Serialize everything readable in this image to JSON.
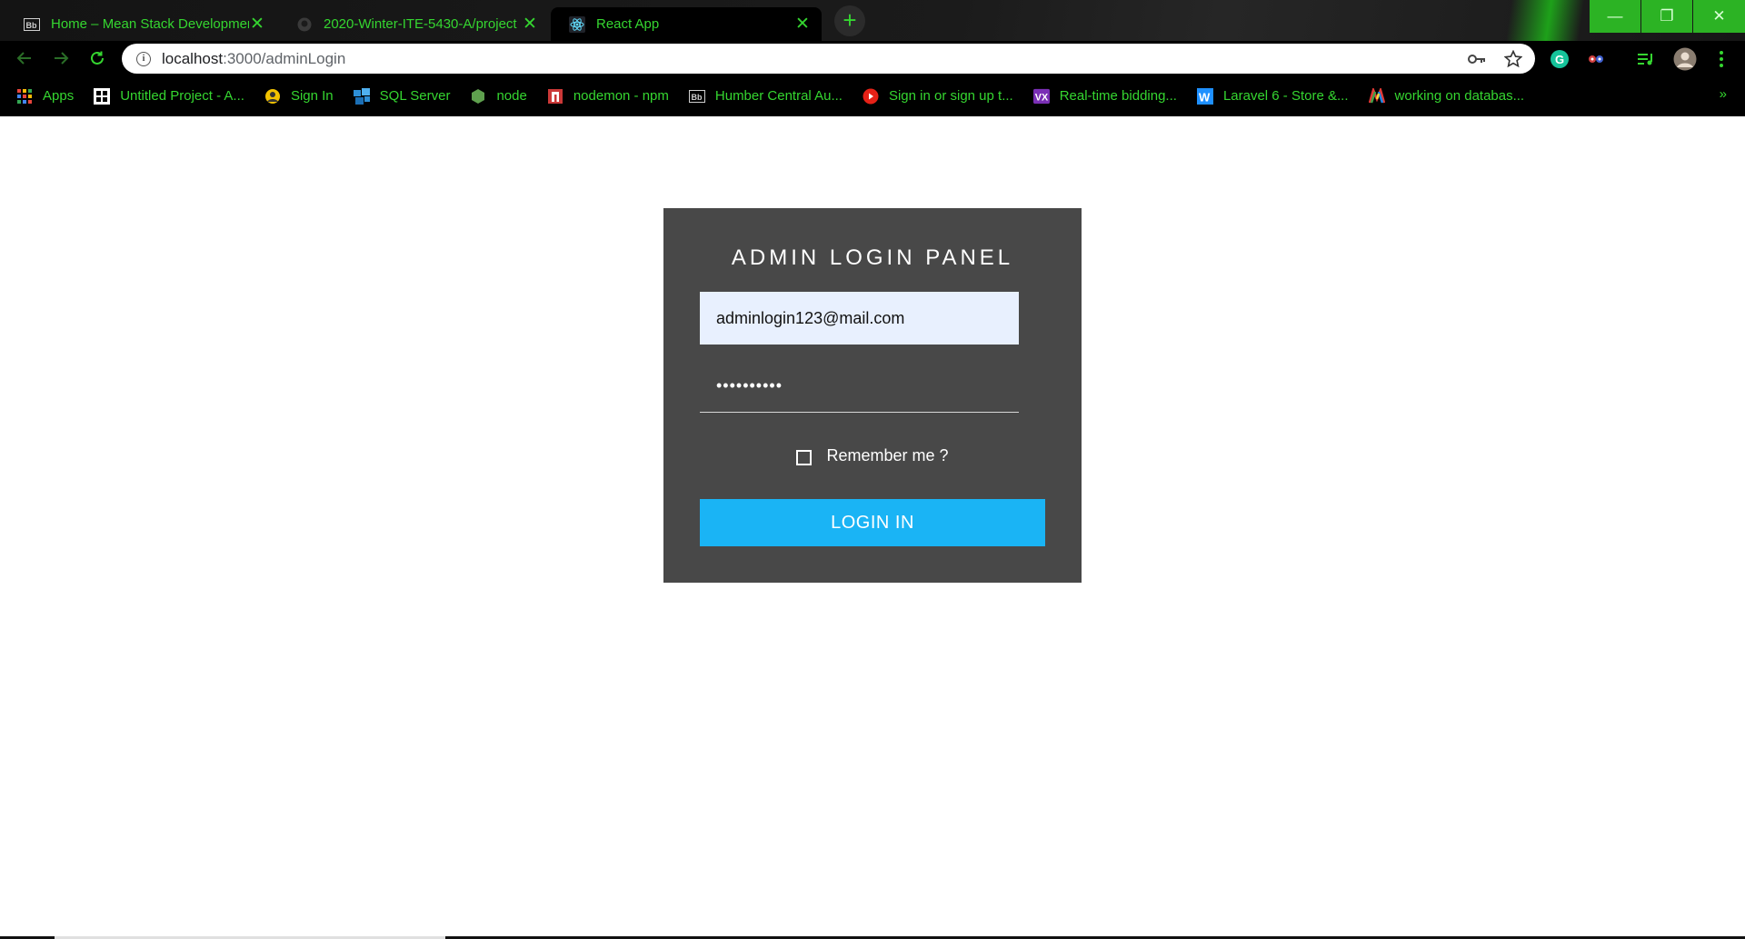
{
  "tabs": [
    {
      "title": "Home – Mean Stack Developmen",
      "favicon": "blackboard-icon",
      "active": false
    },
    {
      "title": "2020-Winter-ITE-5430-A/project",
      "favicon": "github-icon",
      "active": false
    },
    {
      "title": "React App",
      "favicon": "react-icon",
      "active": true
    }
  ],
  "tab_close_glyph": "✕",
  "new_tab_glyph": "+",
  "window_controls": {
    "minimize": "—",
    "restore": "❐",
    "close": "✕"
  },
  "address_bar": {
    "host": "localhost",
    "path": ":3000/adminLogin"
  },
  "bookmarks": [
    {
      "label": "Apps",
      "icon": "apps-grid-icon"
    },
    {
      "label": "Untitled Project - A...",
      "icon": "project-icon"
    },
    {
      "label": "Sign In",
      "icon": "sign-in-icon"
    },
    {
      "label": "SQL Server",
      "icon": "sql-server-icon"
    },
    {
      "label": "node",
      "icon": "node-icon"
    },
    {
      "label": "nodemon - npm",
      "icon": "npm-icon"
    },
    {
      "label": "Humber Central Au...",
      "icon": "blackboard-icon"
    },
    {
      "label": "Sign in or sign up t...",
      "icon": "youtube-icon"
    },
    {
      "label": "Real-time bidding...",
      "icon": "vx-icon"
    },
    {
      "label": "Laravel 6 - Store &...",
      "icon": "w-icon"
    },
    {
      "label": "working on databas...",
      "icon": "colorful-icon"
    }
  ],
  "bookmarks_more": "»",
  "login": {
    "title": "ADMIN LOGIN PANEL",
    "email_value": "adminlogin123@mail.com",
    "password_value": "••••••••••",
    "remember_label": "Remember me ?",
    "remember_checked": false,
    "button_label": "LOGIN IN"
  },
  "colors": {
    "accent_green": "#35d630",
    "panel_bg": "#484848",
    "button_bg": "#1ab4f5",
    "email_bg": "#e8f0fe"
  }
}
